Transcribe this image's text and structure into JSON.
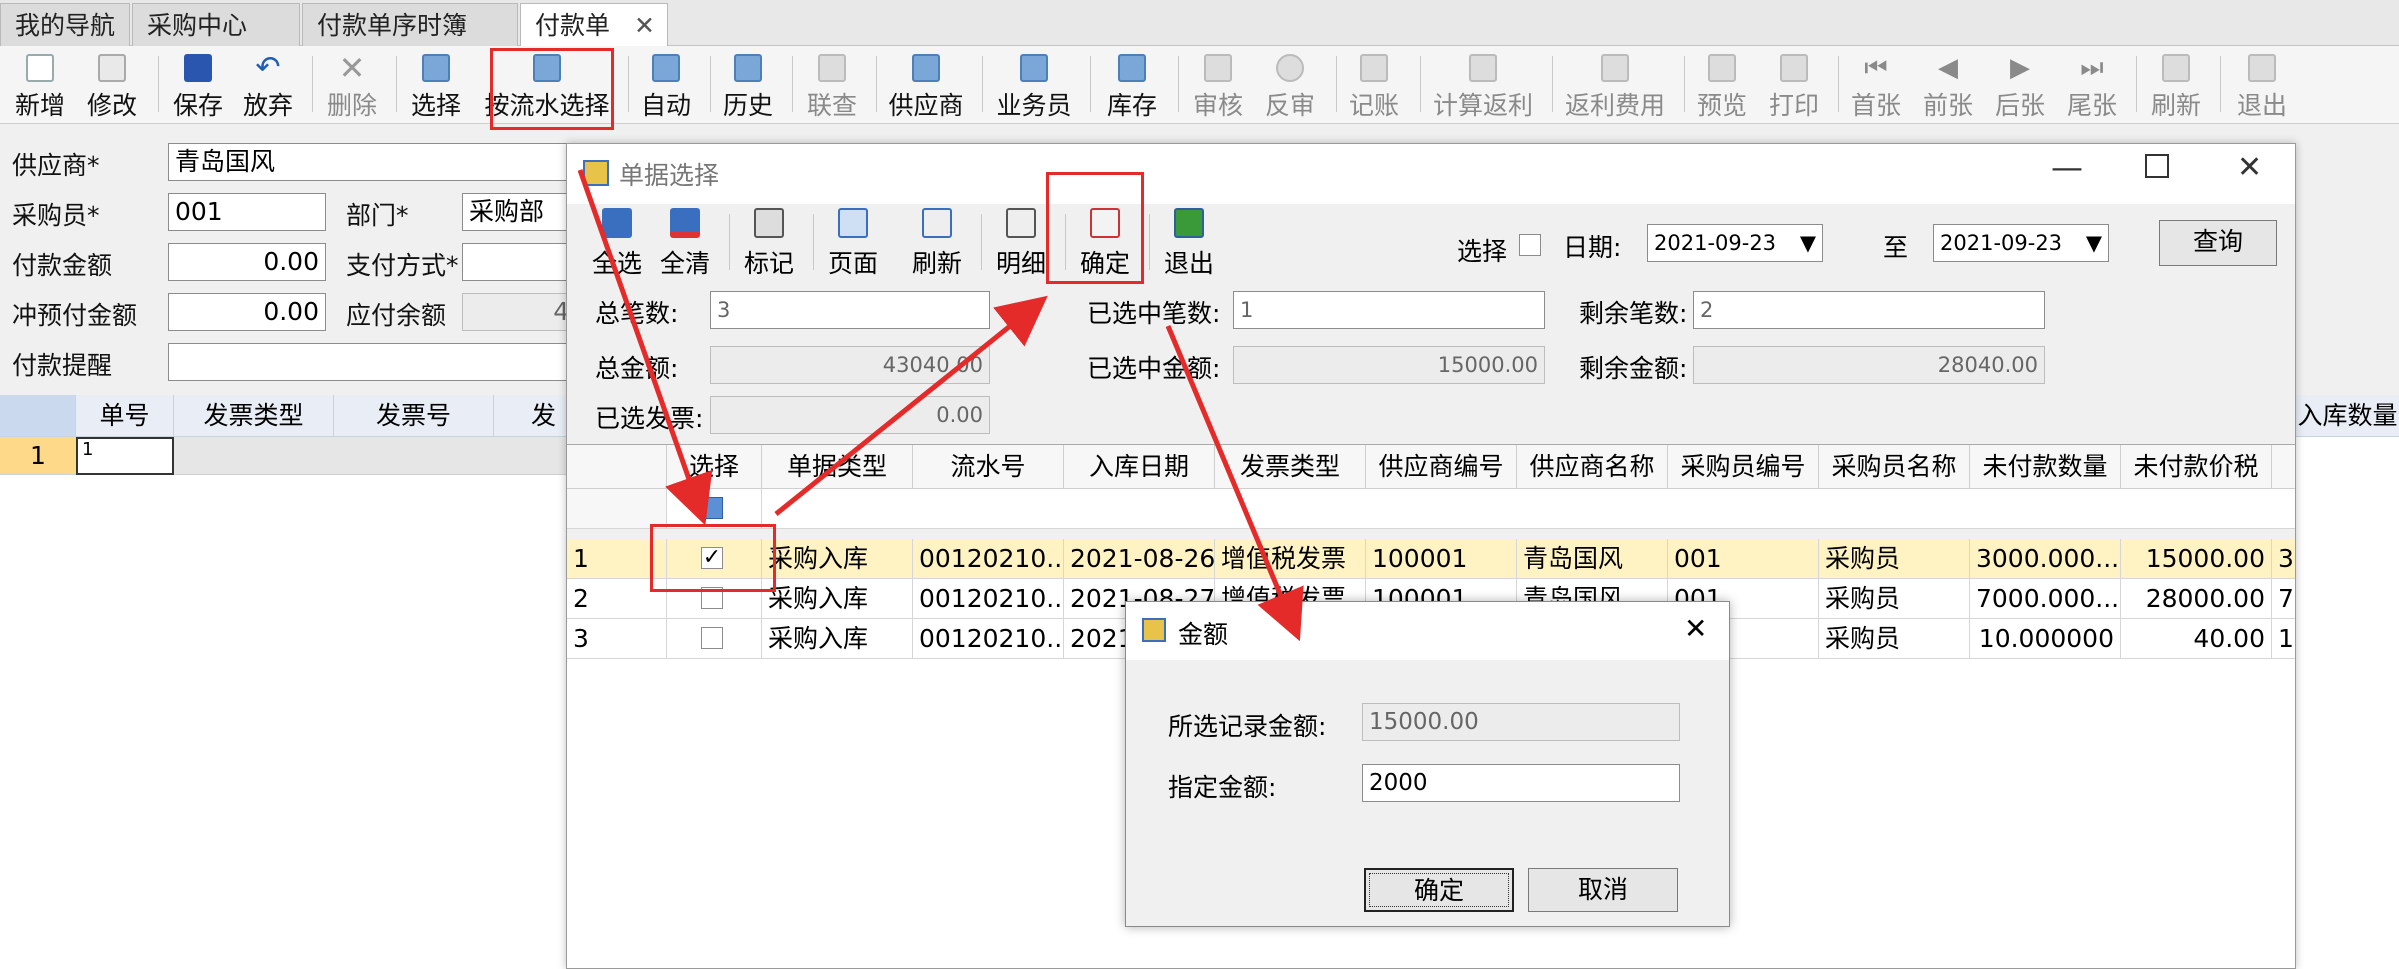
{
  "tabs": [
    "我的导航",
    "采购中心",
    "付款单序时簿",
    "付款单"
  ],
  "toolbar": {
    "buttons": [
      "新增",
      "修改",
      "保存",
      "放弃",
      "删除",
      "选择",
      "按流水选择",
      "自动",
      "历史",
      "联查",
      "供应商",
      "业务员",
      "库存",
      "审核",
      "反审",
      "记账",
      "计算返利",
      "返利费用",
      "预览",
      "打印",
      "首张",
      "前张",
      "后张",
      "尾张",
      "刷新",
      "退出"
    ]
  },
  "form": {
    "supplier_label": "供应商*",
    "supplier_value": "青岛国风",
    "buyer_label": "采购员*",
    "buyer_value": "001",
    "dept_label": "部门*",
    "dept_value": "采购部",
    "amount_label": "付款金额",
    "amount_value": "0.00",
    "pay_method_label": "支付方式*",
    "prepay_label": "冲预付金额",
    "prepay_value": "0.00",
    "balance_label": "应付余额",
    "balance_value": "43",
    "remind_label": "付款提醒"
  },
  "left_grid": {
    "headers": [
      "单号",
      "发票类型",
      "发票号",
      "发"
    ],
    "right_header": "入库数量",
    "row_num": "1",
    "row_value": "1"
  },
  "window": {
    "title": "单据选择",
    "tools": [
      "全选",
      "全清",
      "标记",
      "页面",
      "刷新",
      "明细",
      "确定",
      "退出"
    ],
    "select_label": "选择",
    "date_label": "日期:",
    "date_from": "2021-09-23",
    "to_label": "至",
    "date_to": "2021-09-23",
    "query_label": "查询",
    "summary": {
      "total_count_label": "总笔数:",
      "total_count": "3",
      "selected_count_label": "已选中笔数:",
      "selected_count": "1",
      "remain_count_label": "剩余笔数:",
      "remain_count": "2",
      "total_amount_label": "总金额:",
      "total_amount": "43040.00",
      "selected_amount_label": "已选中金额:",
      "selected_amount": "15000.00",
      "remain_amount_label": "剩余金额:",
      "remain_amount": "28040.00",
      "selected_invoice_label": "已选发票:",
      "selected_invoice": "0.00"
    },
    "columns": [
      "选择",
      "单据类型",
      "流水号",
      "入库日期",
      "发票类型",
      "供应商编号",
      "供应商名称",
      "采购员编号",
      "采购员名称",
      "未付款数量",
      "未付款价税"
    ],
    "rows": [
      {
        "n": "1",
        "checked": true,
        "type": "采购入库",
        "serial": "00120210...",
        "date": "2021-08-26",
        "invoice": "增值税发票",
        "sup_no": "100001",
        "sup_name": "青岛国风",
        "buyer_no": "001",
        "buyer_name": "采购员",
        "qty": "3000.000...",
        "amount": "15000.00",
        "extra": "3"
      },
      {
        "n": "2",
        "checked": false,
        "type": "采购入库",
        "serial": "00120210...",
        "date": "2021-08-27",
        "invoice": "增值税发票",
        "sup_no": "100001",
        "sup_name": "青岛国风",
        "buyer_no": "001",
        "buyer_name": "采购员",
        "qty": "7000.000...",
        "amount": "28000.00",
        "extra": "7"
      },
      {
        "n": "3",
        "checked": false,
        "type": "采购入库",
        "serial": "00120210...",
        "date": "2021",
        "invoice": "",
        "sup_no": "",
        "sup_name": "",
        "buyer_no": "",
        "buyer_name": "采购员",
        "qty": "10.000000",
        "amount": "40.00",
        "extra": "1"
      }
    ]
  },
  "dialog": {
    "title": "金额",
    "sel_amount_label": "所选记录金额:",
    "sel_amount_value": "15000.00",
    "spec_amount_label": "指定金额:",
    "spec_amount_value": "2000",
    "ok_label": "确定",
    "cancel_label": "取消"
  },
  "colors": {
    "annotation": "#e52a2a",
    "selected_row": "#fff3c4",
    "accent": "#1e5fb5"
  }
}
